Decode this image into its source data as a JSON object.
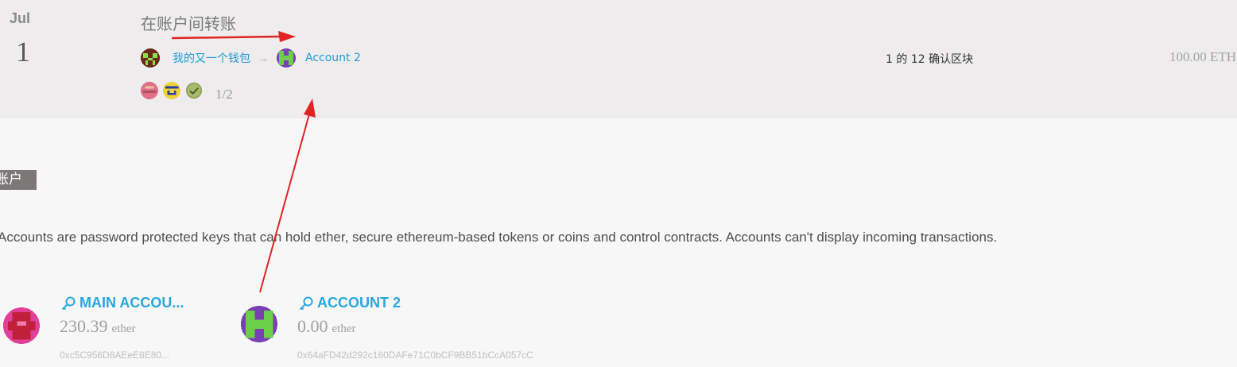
{
  "transaction": {
    "month": "Jul",
    "day": "1",
    "title": "在账户间转账",
    "from_name": "我的又一个钱包",
    "arrow": "→",
    "to_name": "Account 2",
    "owner_count": "1/2",
    "confirm_count": "1",
    "confirm_middle": "的",
    "confirm_total": "12",
    "confirm_suffix": "确认区块",
    "amount": "100.00 ETH"
  },
  "accounts_section": {
    "label": "账户",
    "description": "Accounts are password protected keys that can hold ether, secure ethereum-based tokens or coins and control contracts. Accounts can't display incoming transactions."
  },
  "accounts": [
    {
      "name": "MAIN ACCOU...",
      "balance": "230.39",
      "unit": "ether",
      "address": "0xc5C956D8AEeE8E80..."
    },
    {
      "name": "ACCOUNT 2",
      "balance": "0.00",
      "unit": "ether",
      "address": "0x64aFD42d292c160DAFe71C0bCF9BB51bCcA057cC"
    }
  ],
  "icons": [
    "identicon-wallet",
    "identicon-account2",
    "owner-identicon-1",
    "owner-identicon-2",
    "check-icon",
    "key-icon"
  ],
  "colors": {
    "link": "#1f9bd6",
    "account_name": "#2aa7df",
    "annotation_arrow": "#e02424",
    "row_bg": "#eeecec"
  }
}
